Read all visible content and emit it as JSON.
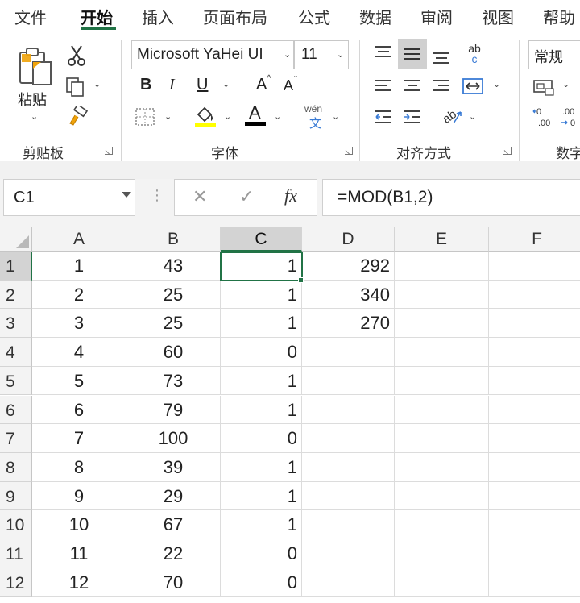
{
  "menu": {
    "tabs": [
      {
        "label": "文件"
      },
      {
        "label": "开始"
      },
      {
        "label": "插入"
      },
      {
        "label": "页面布局"
      },
      {
        "label": "公式"
      },
      {
        "label": "数据"
      },
      {
        "label": "审阅"
      },
      {
        "label": "视图"
      },
      {
        "label": "帮助"
      }
    ],
    "active_tab": "开始"
  },
  "ribbon": {
    "clipboard": {
      "paste_label": "粘贴",
      "group_label": "剪贴板"
    },
    "font": {
      "font_name": "Microsoft YaHei UI",
      "font_size": "11",
      "bold": "B",
      "italic": "I",
      "underline": "U",
      "grow": "A",
      "shrink": "A",
      "phonetic_top": "wén",
      "phonetic_bottom": "文",
      "group_label": "字体",
      "fill_color": "#ffff00",
      "font_color": "#000000"
    },
    "alignment": {
      "group_label": "对齐方式",
      "wrap_icon_text_top": "ab",
      "wrap_icon_text_bottom": "c"
    },
    "number": {
      "format": "常规",
      "group_label": "数字",
      "inc_decimal": "←0 .00",
      "dec_decimal": ".00 →0"
    }
  },
  "formula_bar": {
    "name_box": "C1",
    "cancel": "✕",
    "enter": "✓",
    "fx": "fx",
    "formula": "=MOD(B1,2)"
  },
  "sheet": {
    "columns": [
      "A",
      "B",
      "C",
      "D",
      "E",
      "F"
    ],
    "selected_column": "C",
    "selected_cell": "C1",
    "rows": [
      {
        "row": "1",
        "A": "1",
        "B": "43",
        "C": "1",
        "D": "292"
      },
      {
        "row": "2",
        "A": "2",
        "B": "25",
        "C": "1",
        "D": "340"
      },
      {
        "row": "3",
        "A": "3",
        "B": "25",
        "C": "1",
        "D": "270"
      },
      {
        "row": "4",
        "A": "4",
        "B": "60",
        "C": "0",
        "D": ""
      },
      {
        "row": "5",
        "A": "5",
        "B": "73",
        "C": "1",
        "D": ""
      },
      {
        "row": "6",
        "A": "6",
        "B": "79",
        "C": "1",
        "D": ""
      },
      {
        "row": "7",
        "A": "7",
        "B": "100",
        "C": "0",
        "D": ""
      },
      {
        "row": "8",
        "A": "8",
        "B": "39",
        "C": "1",
        "D": ""
      },
      {
        "row": "9",
        "A": "9",
        "B": "29",
        "C": "1",
        "D": ""
      },
      {
        "row": "10",
        "A": "10",
        "B": "67",
        "C": "1",
        "D": ""
      },
      {
        "row": "11",
        "A": "11",
        "B": "22",
        "C": "0",
        "D": ""
      },
      {
        "row": "12",
        "A": "12",
        "B": "70",
        "C": "0",
        "D": ""
      }
    ]
  },
  "colors": {
    "accent": "#217346"
  }
}
